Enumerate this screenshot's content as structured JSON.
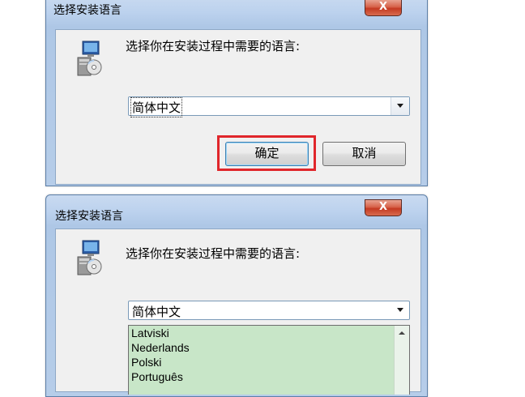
{
  "dialog_top": {
    "title": "选择安装语言",
    "close_glyph": "X",
    "prompt": "选择你在安装过程中需要的语言:",
    "language_value": "简体中文",
    "ok_label": "确定",
    "cancel_label": "取消",
    "icon": "installer-computer-icon"
  },
  "dialog_bottom": {
    "title": "选择安装语言",
    "close_glyph": "X",
    "prompt": "选择你在安装过程中需要的语言:",
    "language_value": "简体中文",
    "icon": "installer-computer-icon",
    "options": [
      "Latviski",
      "Nederlands",
      "Polski",
      "Português"
    ]
  },
  "colors": {
    "highlight": "#e0262b",
    "dropdown_bg": "#c8e6c8",
    "dialog_frame": "#b6cde9"
  }
}
